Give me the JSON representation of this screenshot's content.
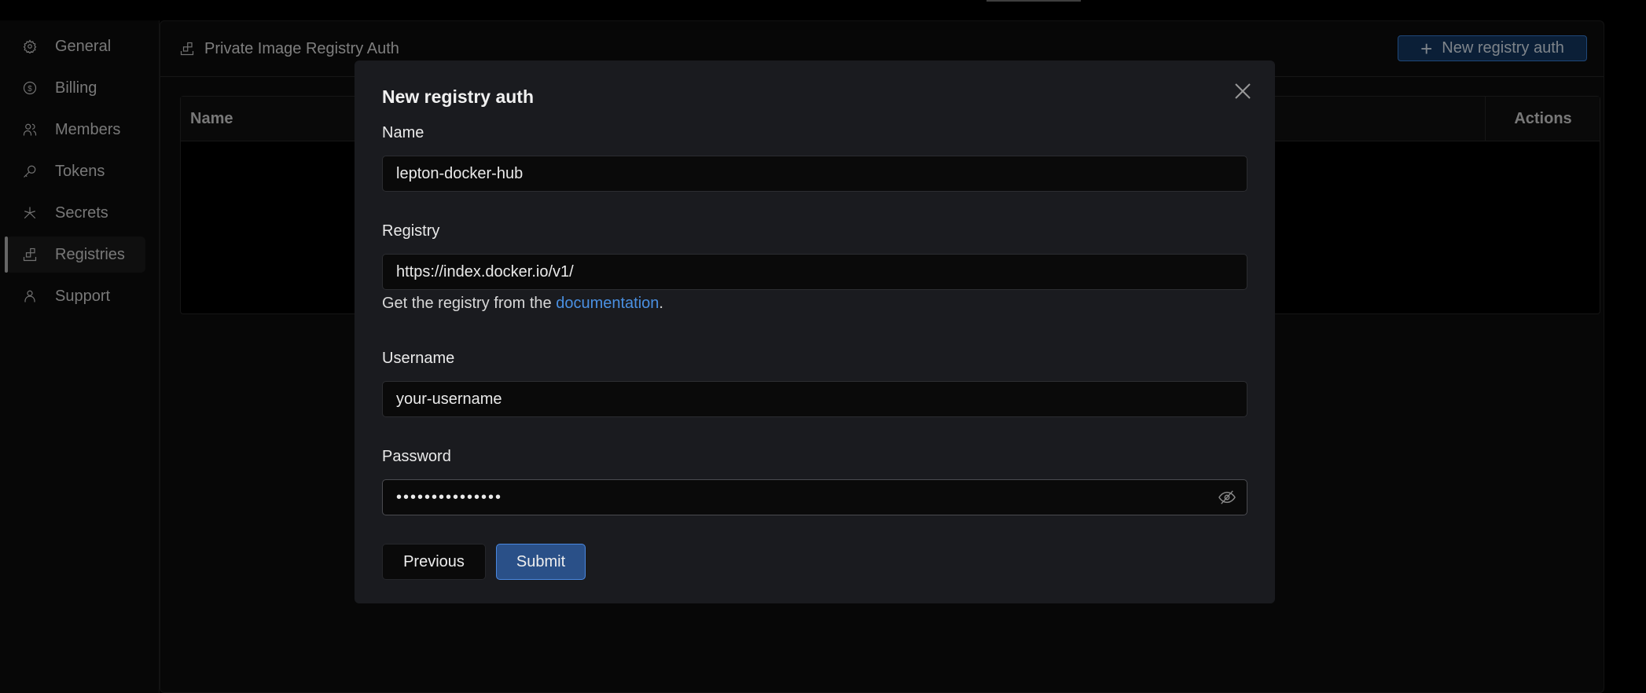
{
  "sidebar": {
    "items": [
      {
        "label": "General",
        "icon": "gear-icon"
      },
      {
        "label": "Billing",
        "icon": "dollar-icon"
      },
      {
        "label": "Members",
        "icon": "users-icon"
      },
      {
        "label": "Tokens",
        "icon": "key-icon"
      },
      {
        "label": "Secrets",
        "icon": "asterisk-icon"
      },
      {
        "label": "Registries",
        "icon": "registry-icon",
        "active": true
      },
      {
        "label": "Support",
        "icon": "user-icon"
      }
    ]
  },
  "header": {
    "title": "Private Image Registry Auth",
    "new_button": "New registry auth"
  },
  "table": {
    "columns": [
      "Name",
      "Actions"
    ]
  },
  "modal": {
    "title": "New registry auth",
    "name_label": "Name",
    "name_value": "lepton-docker-hub",
    "registry_label": "Registry",
    "registry_value": "https://index.docker.io/v1/",
    "help_prefix": "Get the registry from the ",
    "help_link": "documentation",
    "help_suffix": ".",
    "username_label": "Username",
    "username_value": "your-username",
    "password_label": "Password",
    "password_value": "•••••••••••••••",
    "previous": "Previous",
    "submit": "Submit"
  },
  "colors": {
    "accent": "#2a5088",
    "link": "#4a90e2"
  }
}
